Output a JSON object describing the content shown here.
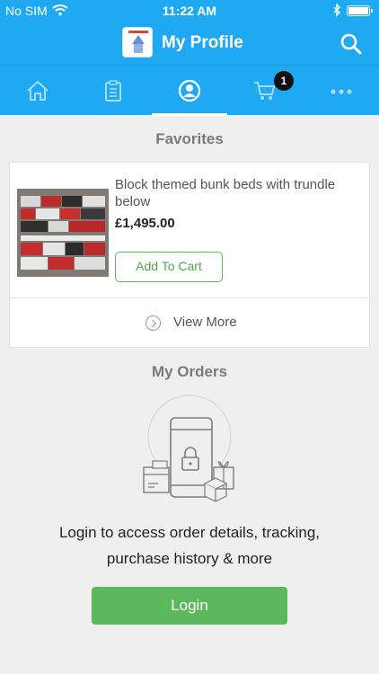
{
  "status_bar": {
    "carrier": "No SIM",
    "time": "11:22 AM"
  },
  "header": {
    "title": "My Profile",
    "logo_icon": "store-logo-icon",
    "search_icon": "search-icon"
  },
  "tabs": [
    {
      "name": "home",
      "icon": "home-icon",
      "active": false
    },
    {
      "name": "catalog",
      "icon": "clipboard-icon",
      "active": false
    },
    {
      "name": "profile",
      "icon": "user-circle-icon",
      "active": true
    },
    {
      "name": "cart",
      "icon": "cart-icon",
      "active": false,
      "badge": "1"
    },
    {
      "name": "more",
      "icon": "more-dots-icon",
      "active": false
    }
  ],
  "favorites": {
    "title": "Favorites",
    "items": [
      {
        "name": "Block themed bunk beds with trundle below",
        "price": "£1,495.00",
        "add_to_cart_label": "Add To Cart"
      }
    ],
    "view_more_label": "View More"
  },
  "orders": {
    "title": "My Orders",
    "message": "Login to access order details, tracking, purchase history & more",
    "login_label": "Login"
  },
  "colors": {
    "primary": "#1fa9f2",
    "accent_green": "#5cb85c",
    "background": "#efefef"
  }
}
